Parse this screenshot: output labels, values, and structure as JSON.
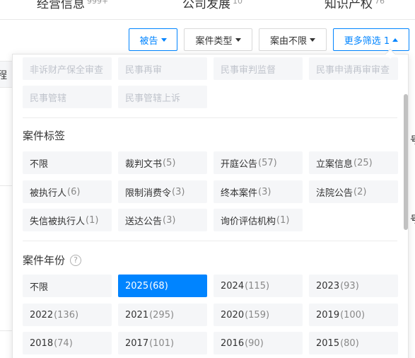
{
  "top_tabs": [
    {
      "label": "经营信息",
      "count": "999+"
    },
    {
      "label": "公司发展",
      "count": "10"
    },
    {
      "label": "知识产权",
      "count": "76"
    }
  ],
  "background": {
    "header_text": "程",
    "right_glyph": "号"
  },
  "filters": {
    "defendant": "被告",
    "case_type": "案件类型",
    "cause": "案由不限",
    "more": "更多筛选 1"
  },
  "panel": {
    "top_rows": [
      [
        "非诉财产保全审查",
        "民事再审",
        "民事审判监督",
        "民事申请再审审查"
      ],
      [
        "民事管辖",
        "民事管辖上诉"
      ]
    ],
    "case_tags": {
      "title": "案件标签",
      "items": [
        {
          "label": "不限",
          "count": ""
        },
        {
          "label": "裁判文书",
          "count": "(5)"
        },
        {
          "label": "开庭公告",
          "count": "(57)"
        },
        {
          "label": "立案信息",
          "count": "(25)"
        },
        {
          "label": "被执行人",
          "count": "(6)"
        },
        {
          "label": "限制消费令",
          "count": "(3)"
        },
        {
          "label": "终本案件",
          "count": "(3)"
        },
        {
          "label": "法院公告",
          "count": "(2)"
        },
        {
          "label": "失信被执行人",
          "count": "(1)"
        },
        {
          "label": "送达公告",
          "count": "(3)"
        },
        {
          "label": "询价评估机构",
          "count": "(1)"
        }
      ]
    },
    "case_year": {
      "title": "案件年份",
      "help": "?",
      "selected": "2025",
      "items": [
        {
          "label": "不限",
          "count": ""
        },
        {
          "label": "2025",
          "count": "(68)"
        },
        {
          "label": "2024",
          "count": "(115)"
        },
        {
          "label": "2023",
          "count": "(93)"
        },
        {
          "label": "2022",
          "count": "(136)"
        },
        {
          "label": "2021",
          "count": "(295)"
        },
        {
          "label": "2020",
          "count": "(159)"
        },
        {
          "label": "2019",
          "count": "(100)"
        },
        {
          "label": "2018",
          "count": "(74)"
        },
        {
          "label": "2017",
          "count": "(101)"
        },
        {
          "label": "2016",
          "count": "(90)"
        },
        {
          "label": "2015",
          "count": "(80)"
        }
      ]
    }
  },
  "colors": {
    "accent": "#0084ff",
    "chip_bg": "#f5f6f8"
  }
}
